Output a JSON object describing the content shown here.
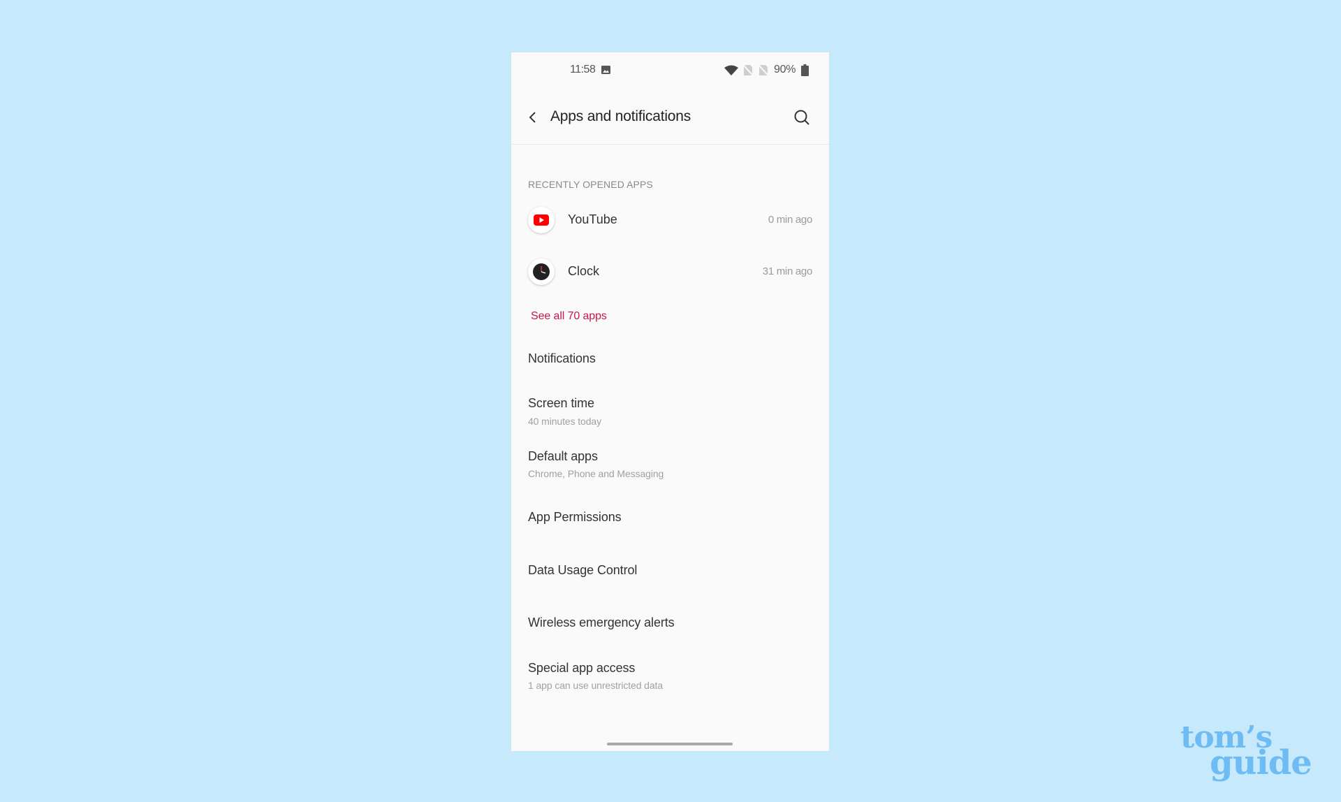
{
  "status_bar": {
    "time": "11:58",
    "battery_percent": "90%",
    "icons": [
      "image-notification-icon",
      "wifi-icon",
      "no-sim-icon",
      "no-sim-icon",
      "battery-icon"
    ]
  },
  "header": {
    "title": "Apps and notifications",
    "back_icon": "chevron-left-icon",
    "search_icon": "search-icon"
  },
  "recent_apps": {
    "section_title": "RECENTLY OPENED APPS",
    "apps": [
      {
        "name": "YouTube",
        "time": "0 min ago",
        "icon": "youtube-icon",
        "color": "#ff0000"
      },
      {
        "name": "Clock",
        "time": "31 min ago",
        "icon": "clock-icon",
        "color": "#222222"
      }
    ],
    "see_all_label": "See all 70 apps"
  },
  "menu": [
    {
      "label": "Notifications",
      "sub": ""
    },
    {
      "label": "Screen time",
      "sub": "40 minutes today"
    },
    {
      "label": "Default apps",
      "sub": "Chrome, Phone and Messaging"
    },
    {
      "label": "App Permissions",
      "sub": ""
    },
    {
      "label": "Data Usage Control",
      "sub": ""
    },
    {
      "label": "Wireless emergency alerts",
      "sub": ""
    },
    {
      "label": "Special app access",
      "sub": "1 app can use unrestricted data"
    }
  ],
  "watermark": {
    "line1": "tom’s",
    "line2": "guide"
  },
  "colors": {
    "background": "#c6e9fc",
    "accent": "#c8174a",
    "logo": "#6fbcf5"
  }
}
